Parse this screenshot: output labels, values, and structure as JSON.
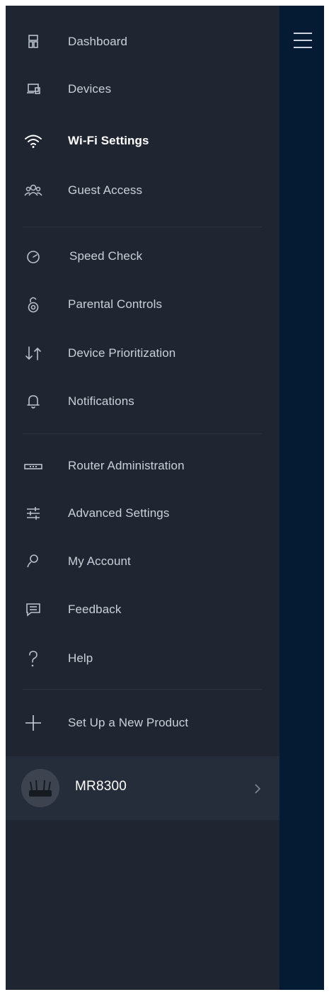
{
  "menu": {
    "group1": [
      {
        "label": "Dashboard",
        "icon": "dashboard-icon"
      },
      {
        "label": "Devices",
        "icon": "devices-icon"
      },
      {
        "label": "Wi-Fi Settings",
        "icon": "wifi-icon",
        "selected": true
      },
      {
        "label": "Guest Access",
        "icon": "guest-access-icon"
      }
    ],
    "group2": [
      {
        "label": "Speed Check",
        "icon": "speedometer-icon"
      },
      {
        "label": "Parental Controls",
        "icon": "lock-icon"
      },
      {
        "label": "Device Prioritization",
        "icon": "priority-arrows-icon"
      },
      {
        "label": "Notifications",
        "icon": "bell-icon"
      }
    ],
    "group3": [
      {
        "label": "Router Administration",
        "icon": "router-icon"
      },
      {
        "label": "Advanced Settings",
        "icon": "sliders-icon"
      },
      {
        "label": "My Account",
        "icon": "user-icon"
      },
      {
        "label": "Feedback",
        "icon": "feedback-icon"
      },
      {
        "label": "Help",
        "icon": "help-icon"
      }
    ],
    "setup": {
      "label": "Set Up a New Product",
      "icon": "plus-icon"
    }
  },
  "product": {
    "name": "MR8300",
    "icon": "router-image"
  },
  "header": {
    "menu_icon": "hamburger-menu-icon"
  },
  "colors": {
    "drawer_bg": "#1f2631",
    "right_rail_bg": "#041b33",
    "text": "#c9d0d8",
    "selected_text": "#ffffff",
    "product_row_bg": "#252d3a"
  }
}
